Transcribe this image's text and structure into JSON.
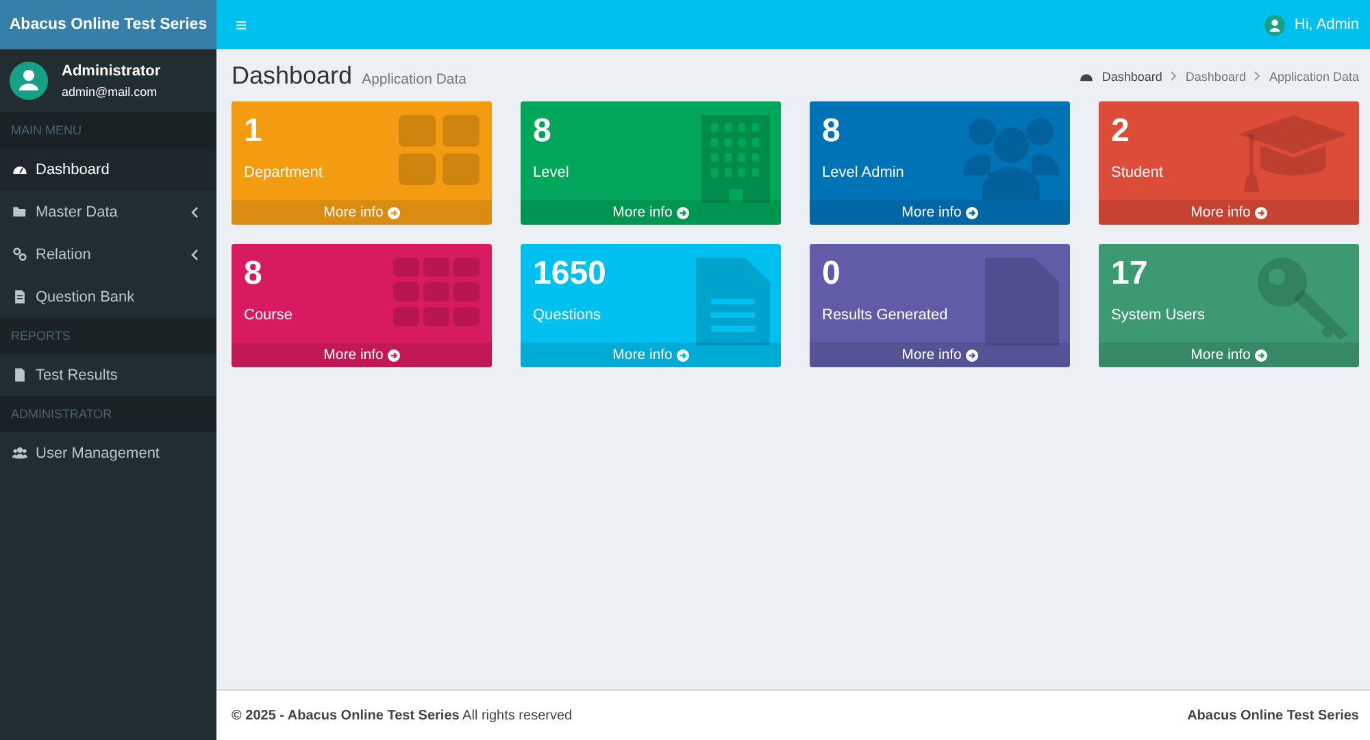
{
  "brand": "Abacus Online Test Series",
  "topbar": {
    "menu_glyph": "≡",
    "user_greeting": "Hi, Admin"
  },
  "user_panel": {
    "name": "Administrator",
    "email": "admin@mail.com"
  },
  "sidebar": {
    "items": [
      {
        "kind": "header",
        "label": "MAIN MENU"
      },
      {
        "kind": "item",
        "label": "Dashboard",
        "selected": true,
        "has_submenu": false
      },
      {
        "kind": "item",
        "label": "Master Data",
        "selected": false,
        "has_submenu": true
      },
      {
        "kind": "item",
        "label": "Relation",
        "selected": false,
        "has_submenu": true
      },
      {
        "kind": "item",
        "label": "Question Bank",
        "selected": false,
        "has_submenu": false
      },
      {
        "kind": "header",
        "label": "REPORTS"
      },
      {
        "kind": "item",
        "label": "Test Results",
        "selected": false,
        "has_submenu": false
      },
      {
        "kind": "header",
        "label": "ADMINISTRATOR"
      },
      {
        "kind": "item",
        "label": "User Management",
        "selected": false,
        "has_submenu": false
      }
    ]
  },
  "page_header": {
    "title": "Dashboard",
    "subtitle": "Application Data"
  },
  "breadcrumb": [
    "Dashboard",
    "Dashboard",
    "Application Data"
  ],
  "cards": [
    {
      "count": "1",
      "label": "Department",
      "link": "More info",
      "color": "#f39c12"
    },
    {
      "count": "8",
      "label": "Level",
      "link": "More info",
      "color": "#00a65a"
    },
    {
      "count": "8",
      "label": "Level Admin",
      "link": "More info",
      "color": "#0073b7"
    },
    {
      "count": "2",
      "label": "Student",
      "link": "More info",
      "color": "#dd4b39"
    },
    {
      "count": "8",
      "label": "Course",
      "link": "More info",
      "color": "#d81b60"
    },
    {
      "count": "1650",
      "label": "Questions",
      "link": "More info",
      "color": "#00c0ef"
    },
    {
      "count": "0",
      "label": "Results Generated",
      "link": "More info",
      "color": "#605ca8"
    },
    {
      "count": "17",
      "label": "System Users",
      "link": "More info",
      "color": "#3d9970"
    }
  ],
  "footer": {
    "copyright": "**© 2025 - Abacus Online Test Series** All rights reserved",
    "brand": "Abacus Online Test Series"
  }
}
